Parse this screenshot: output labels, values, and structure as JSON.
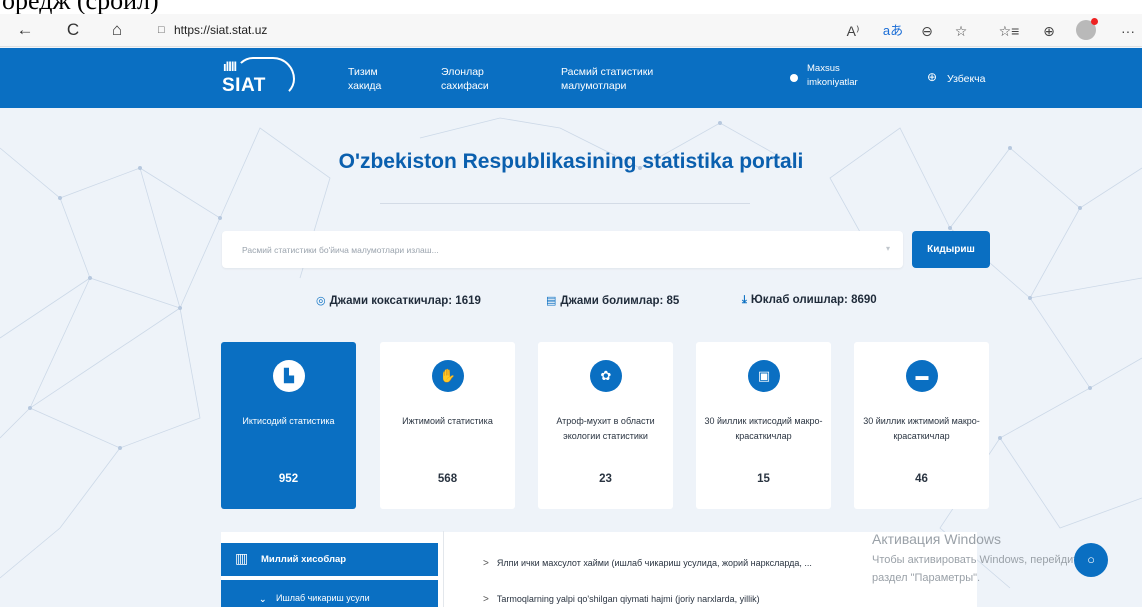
{
  "top_clip": {
    "text": "оредж (сройл)"
  },
  "browser": {
    "url": "https://siat.stat.uz",
    "back_icon": "←",
    "reload_icon": "C",
    "home_icon": "⌂",
    "lock_icon": "🔒",
    "read_aloud_icon": "A⁾",
    "translate_icon": "aあ",
    "zoom_icon": "⊖",
    "fav_add_icon": "☆",
    "favorites_icon": "☆≡",
    "collections_icon": "⊕",
    "more_icon": "···"
  },
  "header": {
    "logo_bars": "ıllll",
    "logo_text": "SIAT",
    "menu": [
      {
        "line1": "Тизим",
        "line2": "хакида"
      },
      {
        "line1": "Элонлар",
        "line2": "сахифаси"
      },
      {
        "line1": "Расмий статистики",
        "line2": "малумотлари"
      },
      {
        "line1": "Maxsus",
        "line2": "imkoniyatlar"
      }
    ],
    "language": "Узбекча",
    "globe_icon": "⊕"
  },
  "hero": {
    "title": "O'zbekiston Respublikasining statistika portali",
    "search_placeholder": "Расмий статистики бо'йича малумотлари излаш...",
    "search_caret": "▾",
    "search_button": "Кидыриш"
  },
  "stats": [
    {
      "icon": "◎",
      "text": "Джами коксаткичлар: 1619"
    },
    {
      "icon": "▤",
      "text": "Джами болимлар: 85"
    },
    {
      "icon": "⤓",
      "text": "Юклаб олишлар: 8690"
    }
  ],
  "cards": [
    {
      "icon": "▙",
      "label": "Иктисодий статистика",
      "count": "952"
    },
    {
      "icon": "✋",
      "label": "Ижтимоий статистика",
      "count": "568"
    },
    {
      "icon": "✿",
      "label": "Атроф-мухит в области экологии статистики",
      "count": "23"
    },
    {
      "icon": "▣",
      "label": "30 йиллик иктисодий макро-красаткичлар",
      "count": "15"
    },
    {
      "icon": "▬",
      "label": "30 йиллик ижтимоий макро-красаткичлар",
      "count": "46"
    }
  ],
  "panel": {
    "side": [
      {
        "icon": "▥",
        "label": "Миллий хисоблар"
      },
      {
        "icon": "⌄",
        "label": "Ишлаб чикариш усули"
      }
    ],
    "rows": [
      "Ялпи ички махсулот хайми (ишлаб чикариш усулида, жорий наркслардa, ...",
      "Tarmoqlarning yalpi qo'shilgan qiymati hajmi (joriy narxlarda, yillik)"
    ]
  },
  "watermark": {
    "line1": "Активация Windows",
    "line2": "Чтобы активировать Windows, перейдите",
    "line3": "раздел \"Параметры\"."
  },
  "chat_icon": "💬"
}
